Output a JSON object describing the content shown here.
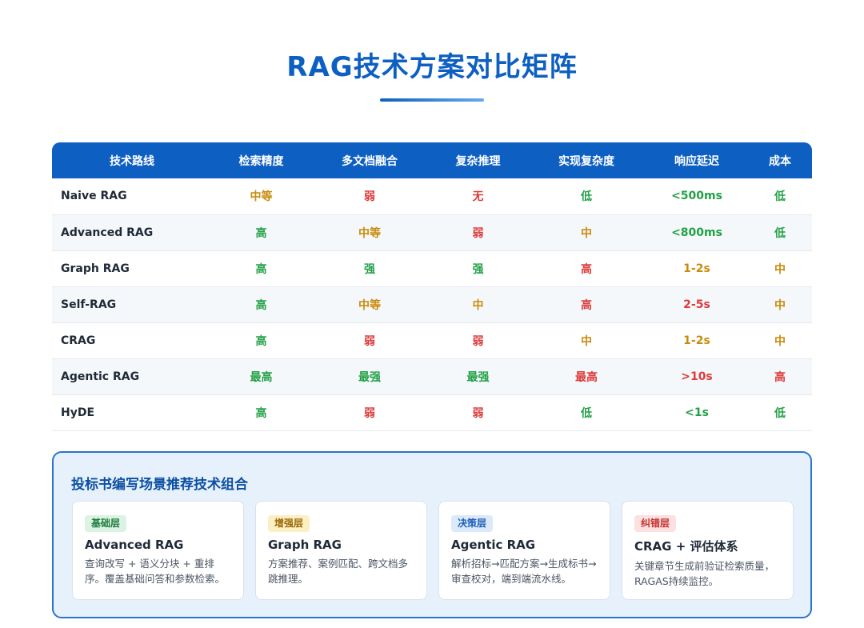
{
  "title": "RAG技术方案对比矩阵",
  "table": {
    "headers": [
      "技术路线",
      "检索精度",
      "多文档融合",
      "复杂推理",
      "实现复杂度",
      "响应延迟",
      "成本"
    ],
    "rows": [
      [
        "Naive RAG",
        "中等",
        "弱",
        "无",
        "低",
        "<500ms",
        "低"
      ],
      [
        "Advanced RAG",
        "高",
        "中等",
        "弱",
        "中",
        "<800ms",
        "低"
      ],
      [
        "Graph RAG",
        "高",
        "强",
        "强",
        "高",
        "1-2s",
        "中"
      ],
      [
        "Self-RAG",
        "高",
        "中等",
        "中",
        "高",
        "2-5s",
        "中"
      ],
      [
        "CRAG",
        "高",
        "弱",
        "弱",
        "中",
        "1-2s",
        "中"
      ],
      [
        "Agentic RAG",
        "最高",
        "最强",
        "最强",
        "最高",
        ">10s",
        "高"
      ],
      [
        "HyDE",
        "高",
        "弱",
        "弱",
        "低",
        "<1s",
        "低"
      ]
    ],
    "row_colors": [
      [
        "amber",
        "red",
        "red",
        "green",
        "green",
        "green"
      ],
      [
        "green",
        "amber",
        "red",
        "amber",
        "green",
        "green"
      ],
      [
        "green",
        "green",
        "green",
        "red",
        "amber",
        "amber"
      ],
      [
        "green",
        "amber",
        "amber",
        "red",
        "red",
        "amber"
      ],
      [
        "green",
        "red",
        "red",
        "amber",
        "amber",
        "amber"
      ],
      [
        "green",
        "green",
        "green",
        "red",
        "red",
        "red"
      ],
      [
        "green",
        "red",
        "red",
        "green",
        "green",
        "green"
      ]
    ]
  },
  "recommendation": {
    "title": "投标书编写场景推荐技术组合",
    "cards": [
      {
        "badge": "基础层",
        "name": "Advanced RAG",
        "desc": "查询改写 + 语义分块 + 重排序。覆盖基础问答和参数检索。"
      },
      {
        "badge": "增强层",
        "name": "Graph RAG",
        "desc": "方案推荐、案例匹配、跨文档多跳推理。"
      },
      {
        "badge": "决策层",
        "name": "Agentic RAG",
        "desc": "解析招标→匹配方案→生成标书→审查校对，端到端流水线。"
      },
      {
        "badge": "纠错层",
        "name": "CRAG + 评估体系",
        "desc": "关键章节生成前验证检索质量，RAGAS持续监控。"
      }
    ]
  },
  "colors": {
    "green": "#22a046",
    "amber": "#c98a0c",
    "red": "#dc3b3b",
    "header_blue": "#0d5fc2"
  }
}
